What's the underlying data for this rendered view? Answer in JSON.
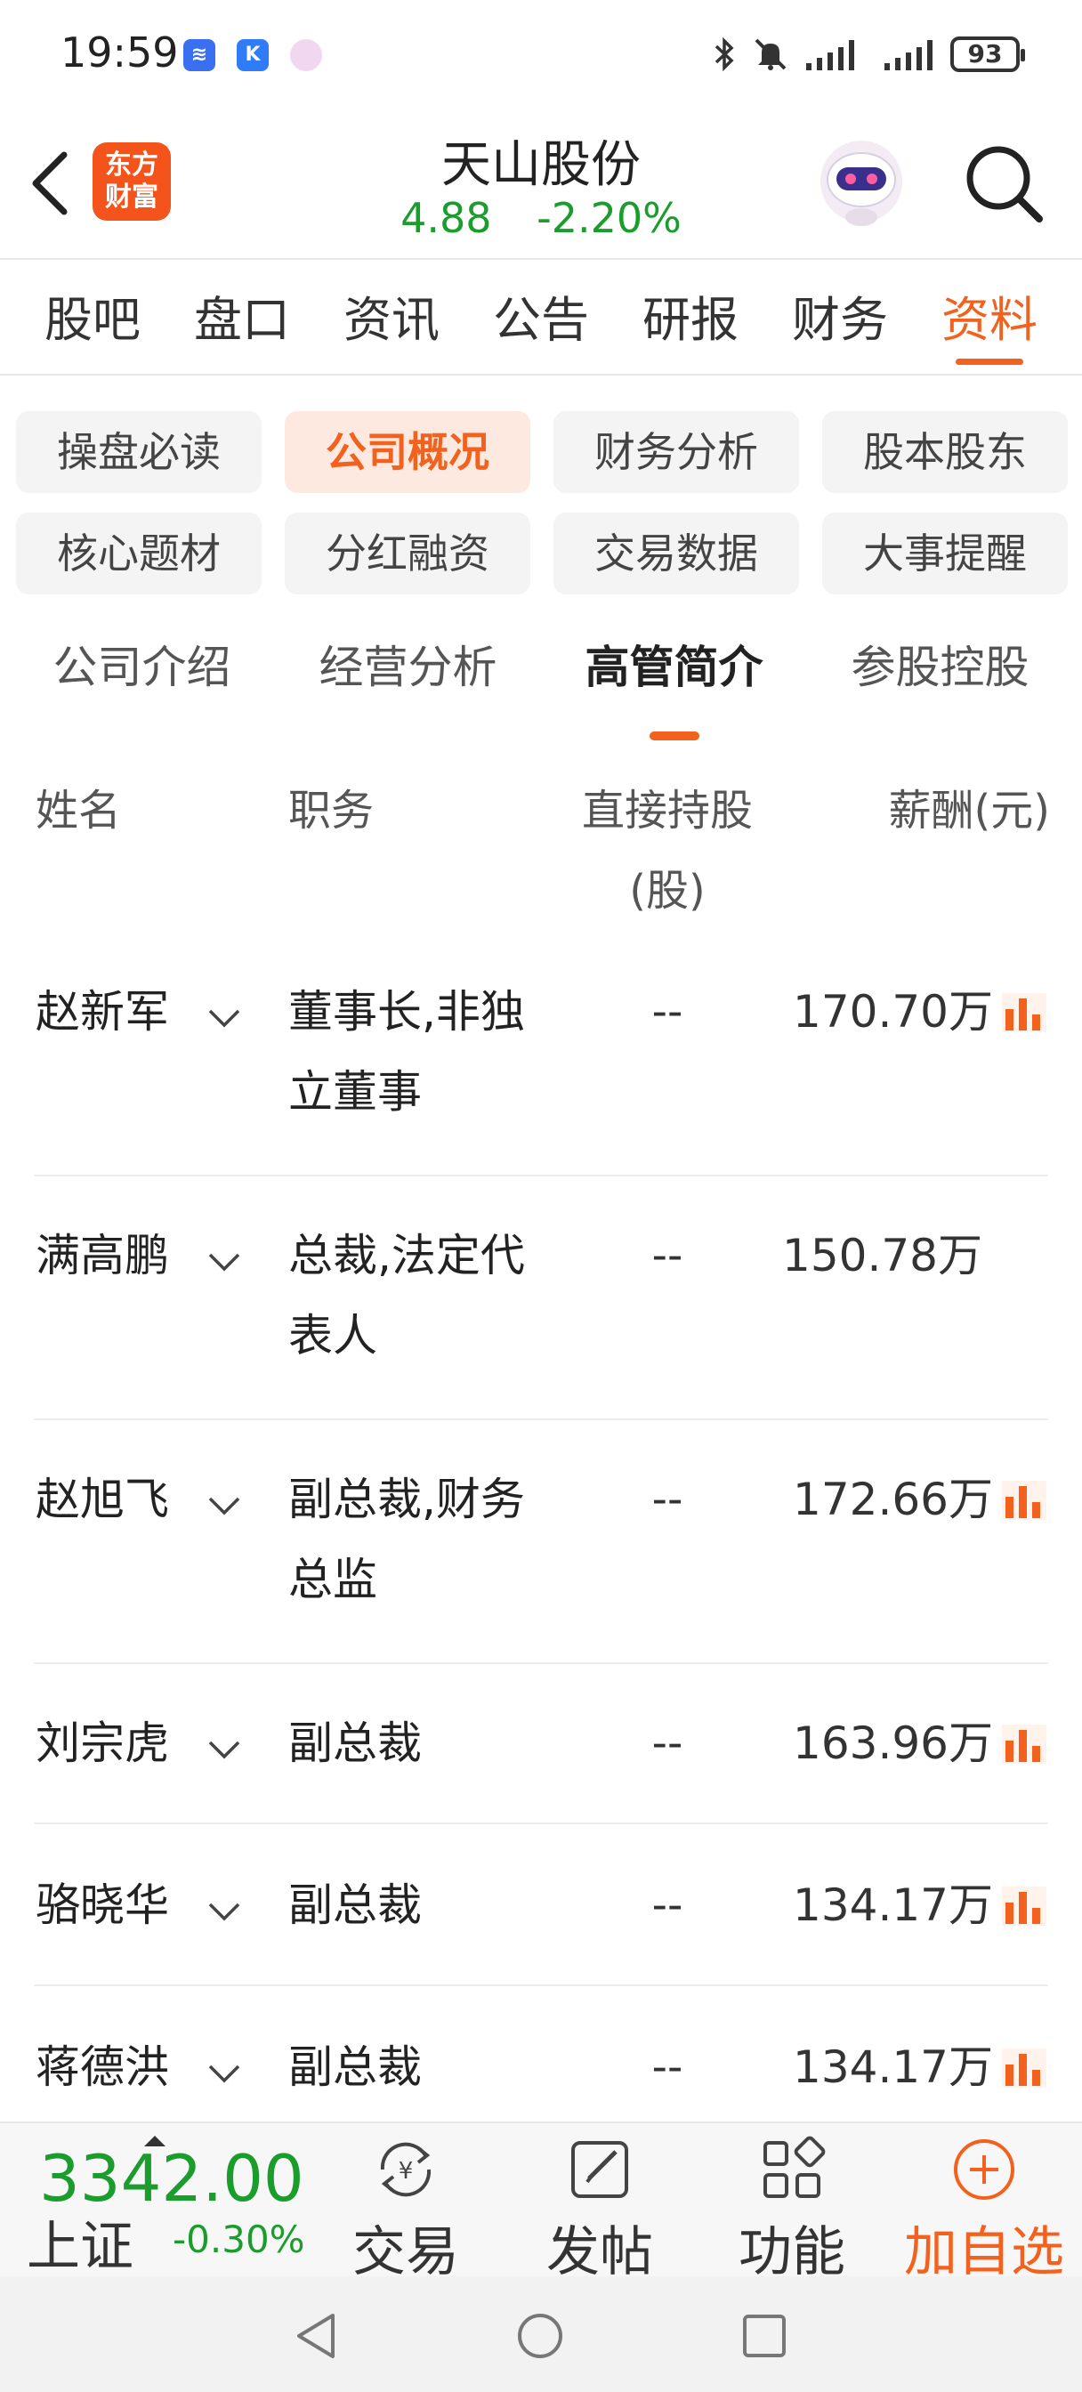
{
  "status_bar": {
    "time": "19:59",
    "battery": "93"
  },
  "header": {
    "logo_line1": "东方",
    "logo_line2": "财富",
    "title": "天山股份",
    "price": "4.88",
    "change": "-2.20%"
  },
  "main_tabs": [
    "股吧",
    "盘口",
    "资讯",
    "公告",
    "研报",
    "财务",
    "资料"
  ],
  "categories": [
    "操盘必读",
    "公司概况",
    "财务分析",
    "股本股东",
    "核心题材",
    "分红融资",
    "交易数据",
    "大事提醒"
  ],
  "sub_tabs": [
    "公司介绍",
    "经营分析",
    "高管简介",
    "参股控股"
  ],
  "table": {
    "headers": {
      "name": "姓名",
      "role": "职务",
      "shares_line1": "直接持股",
      "shares_line2": "(股)",
      "salary": "薪酬(元)"
    },
    "rows": [
      {
        "name": "赵新军",
        "role_line1": "董事长,非独",
        "role_line2": "立董事",
        "shares": "--",
        "salary": "170.70万"
      },
      {
        "name": "满高鹏",
        "role_line1": "总裁,法定代",
        "role_line2": "表人",
        "shares": "--",
        "salary": "150.78万"
      },
      {
        "name": "赵旭飞",
        "role_line1": "副总裁,财务",
        "role_line2": "总监",
        "shares": "--",
        "salary": "172.66万"
      },
      {
        "name": "刘宗虎",
        "role_line1": "副总裁",
        "role_line2": "",
        "shares": "--",
        "salary": "163.96万"
      },
      {
        "name": "骆晓华",
        "role_line1": "副总裁",
        "role_line2": "",
        "shares": "--",
        "salary": "134.17万"
      },
      {
        "name": "蒋德洪",
        "role_line1": "副总裁",
        "role_line2": "",
        "shares": "--",
        "salary": "134.17万"
      }
    ]
  },
  "bottom_bar": {
    "index_value": "3342.00",
    "index_name": "上证",
    "index_change": "-0.30%",
    "trade": "交易",
    "post": "发帖",
    "functions": "功能",
    "add_watch": "加自选"
  },
  "colors": {
    "accent": "#f2611d",
    "down": "#1a9d2c"
  }
}
